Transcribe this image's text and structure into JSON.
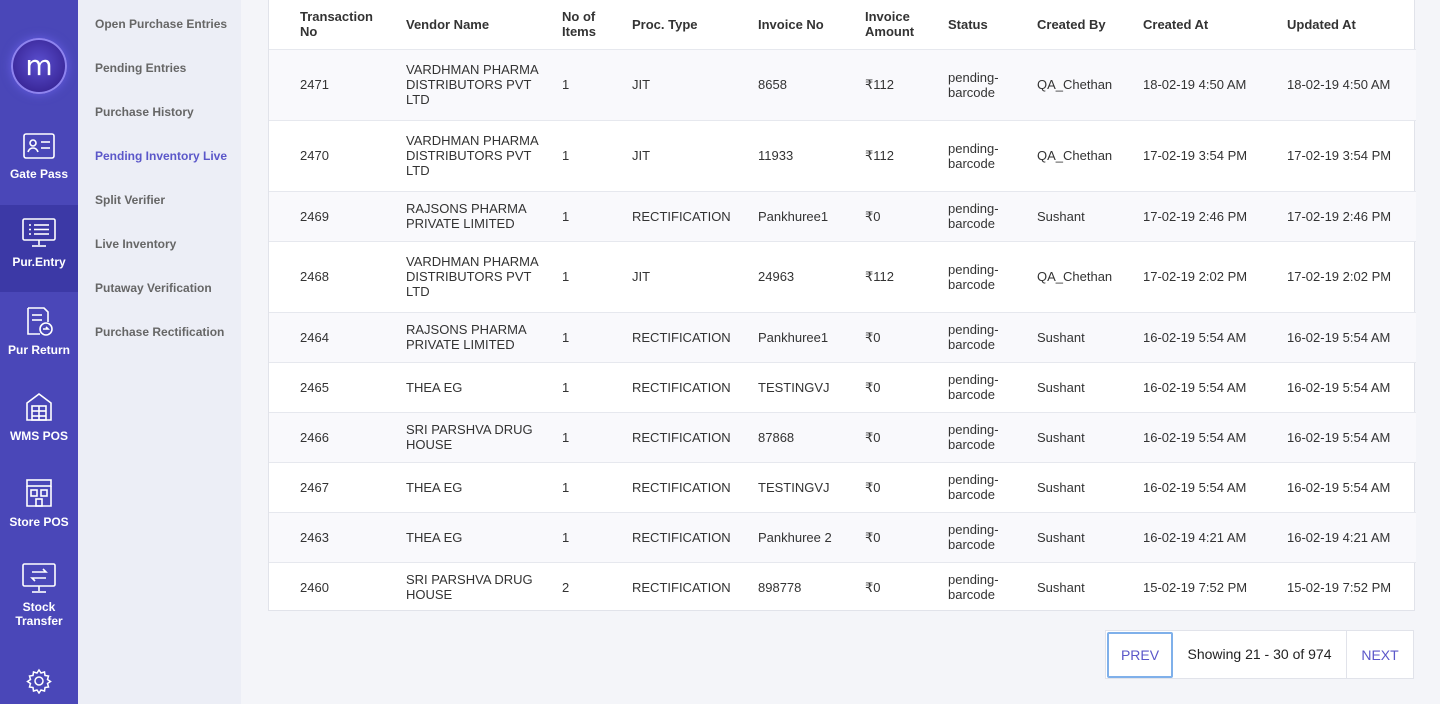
{
  "brand": {
    "logo_letter": "m"
  },
  "rail": [
    {
      "label": "Gate Pass",
      "icon": "id-card-icon"
    },
    {
      "label": "Pur.Entry",
      "icon": "monitor-list-icon",
      "active": true
    },
    {
      "label": "Pur Return",
      "icon": "document-return-icon"
    },
    {
      "label": "WMS POS",
      "icon": "warehouse-icon"
    },
    {
      "label": "Store POS",
      "icon": "storefront-icon"
    },
    {
      "label": "Stock",
      "label2": "Transfer",
      "icon": "transfer-icon"
    }
  ],
  "subnav": [
    {
      "label": "Open Purchase Entries"
    },
    {
      "label": "Pending Entries"
    },
    {
      "label": "Purchase History"
    },
    {
      "label": "Pending Inventory Live",
      "active": true
    },
    {
      "label": "Split Verifier"
    },
    {
      "label": "Live Inventory"
    },
    {
      "label": "Putaway Verification"
    },
    {
      "label": "Purchase Rectification"
    }
  ],
  "table": {
    "headers": [
      "Transaction No",
      "Vendor Name",
      "No of Items",
      "Proc. Type",
      "Invoice No",
      "Invoice Amount",
      "Status",
      "Created By",
      "Created At",
      "Updated At"
    ],
    "rows": [
      [
        "2471",
        "VARDHMAN PHARMA DISTRIBUTORS PVT LTD",
        "1",
        "JIT",
        "8658",
        "₹112",
        "pending-barcode",
        "QA_Chethan",
        "18-02-19 4:50 AM",
        "18-02-19 4:50 AM"
      ],
      [
        "2470",
        "VARDHMAN PHARMA DISTRIBUTORS PVT LTD",
        "1",
        "JIT",
        "11933",
        "₹112",
        "pending-barcode",
        "QA_Chethan",
        "17-02-19 3:54 PM",
        "17-02-19 3:54 PM"
      ],
      [
        "2469",
        "RAJSONS PHARMA PRIVATE LIMITED",
        "1",
        "RECTIFICATION",
        "Pankhuree1",
        "₹0",
        "pending-barcode",
        "Sushant",
        "17-02-19 2:46 PM",
        "17-02-19 2:46 PM"
      ],
      [
        "2468",
        "VARDHMAN PHARMA DISTRIBUTORS PVT LTD",
        "1",
        "JIT",
        "24963",
        "₹112",
        "pending-barcode",
        "QA_Chethan",
        "17-02-19 2:02 PM",
        "17-02-19 2:02 PM"
      ],
      [
        "2464",
        "RAJSONS PHARMA PRIVATE LIMITED",
        "1",
        "RECTIFICATION",
        "Pankhuree1",
        "₹0",
        "pending-barcode",
        "Sushant",
        "16-02-19 5:54 AM",
        "16-02-19 5:54 AM"
      ],
      [
        "2465",
        "THEA EG",
        "1",
        "RECTIFICATION",
        "TESTINGVJ",
        "₹0",
        "pending-barcode",
        "Sushant",
        "16-02-19 5:54 AM",
        "16-02-19 5:54 AM"
      ],
      [
        "2466",
        "SRI PARSHVA DRUG HOUSE",
        "1",
        "RECTIFICATION",
        "87868",
        "₹0",
        "pending-barcode",
        "Sushant",
        "16-02-19 5:54 AM",
        "16-02-19 5:54 AM"
      ],
      [
        "2467",
        "THEA EG",
        "1",
        "RECTIFICATION",
        "TESTINGVJ",
        "₹0",
        "pending-barcode",
        "Sushant",
        "16-02-19 5:54 AM",
        "16-02-19 5:54 AM"
      ],
      [
        "2463",
        "THEA EG",
        "1",
        "RECTIFICATION",
        "Pankhuree 2",
        "₹0",
        "pending-barcode",
        "Sushant",
        "16-02-19 4:21 AM",
        "16-02-19 4:21 AM"
      ],
      [
        "2460",
        "SRI PARSHVA DRUG HOUSE",
        "2",
        "RECTIFICATION",
        "898778",
        "₹0",
        "pending-barcode",
        "Sushant",
        "15-02-19 7:52 PM",
        "15-02-19 7:52 PM"
      ]
    ]
  },
  "pager": {
    "prev_label": "PREV",
    "showing": "Showing 21 - 30 of 974",
    "next_label": "NEXT"
  },
  "colors": {
    "rail_bg": "#4a47b8",
    "rail_active": "#3c39a6",
    "accent": "#5b57c9",
    "subnav_bg": "#eceef6"
  }
}
